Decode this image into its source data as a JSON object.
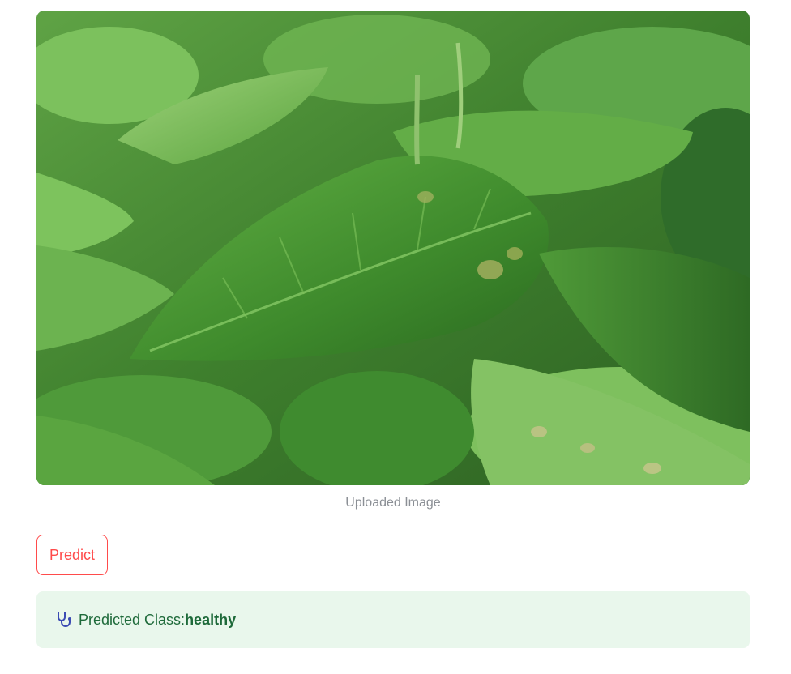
{
  "image": {
    "caption": "Uploaded Image",
    "alt_icon": "uploaded-leaf-photo"
  },
  "predict_button": {
    "label": "Predict"
  },
  "result": {
    "icon": "stethoscope-icon",
    "label": "Predicted Class: ",
    "value": "healthy"
  },
  "colors": {
    "button_accent": "#ff4b4b",
    "result_bg": "#e9f7ec",
    "result_text": "#1e6a3a",
    "caption_text": "#8b8f95"
  }
}
